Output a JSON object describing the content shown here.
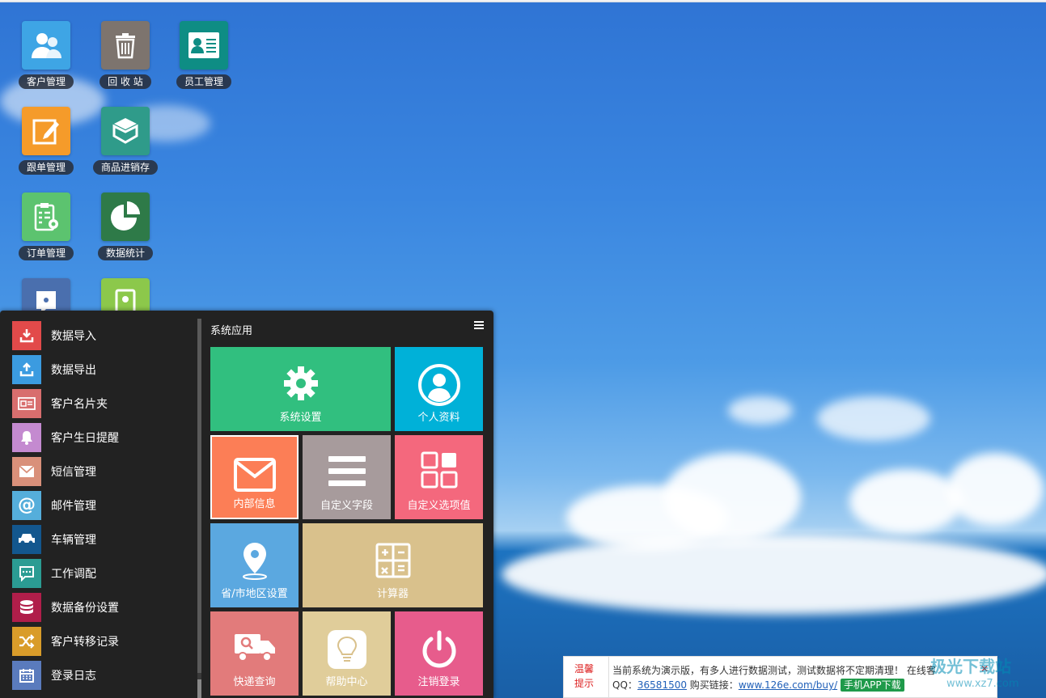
{
  "desktop": {
    "icons": [
      {
        "label": "客户管理",
        "color": "#3ea5e5",
        "icon": "customers-icon"
      },
      {
        "label": "回 收 站",
        "color": "#7d746e",
        "icon": "trash-icon"
      },
      {
        "label": "员工管理",
        "color": "#0e8d84",
        "icon": "id-card-icon"
      },
      {
        "label": "跟单管理",
        "color": "#f59b2a",
        "icon": "edit-icon"
      },
      {
        "label": "商品进销存",
        "color": "#2f9b8a",
        "icon": "box-icon"
      },
      {
        "label": "订单管理",
        "color": "#5cc36f",
        "icon": "clipboard-settings-icon"
      },
      {
        "label": "数据统计",
        "color": "#2e7a48",
        "icon": "pie-chart-icon"
      },
      {
        "label": "",
        "color": "#4a6fae",
        "icon": "chat-icon"
      },
      {
        "label": "",
        "color": "#8cc84b",
        "icon": "contacts-icon"
      }
    ]
  },
  "start_menu": {
    "items": [
      {
        "label": "数据导入",
        "color": "#e24a4a",
        "icon": "download-icon"
      },
      {
        "label": "数据导出",
        "color": "#3b9be0",
        "icon": "upload-icon"
      },
      {
        "label": "客户名片夹",
        "color": "#d86e6e",
        "icon": "business-card-icon"
      },
      {
        "label": "客户生日提醒",
        "color": "#c48ad0",
        "icon": "bell-icon"
      },
      {
        "label": "短信管理",
        "color": "#d9907a",
        "icon": "mail-icon"
      },
      {
        "label": "邮件管理",
        "color": "#55aedb",
        "icon": "at-icon"
      },
      {
        "label": "车辆管理",
        "color": "#13578e",
        "icon": "car-icon"
      },
      {
        "label": "工作调配",
        "color": "#2b9c93",
        "icon": "message-icon"
      },
      {
        "label": "数据备份设置",
        "color": "#b01e4a",
        "icon": "database-icon"
      },
      {
        "label": "客户转移记录",
        "color": "#d99c2a",
        "icon": "shuffle-icon"
      },
      {
        "label": "登录日志",
        "color": "#5a7bbd",
        "icon": "calendar-icon"
      }
    ],
    "section_title": "系统应用",
    "tiles": [
      {
        "label": "系统设置",
        "color": "#31bf7f",
        "icon": "gear-icon"
      },
      {
        "label": "个人资料",
        "color": "#00b1d8",
        "icon": "user-circle-icon"
      },
      {
        "label": "内部信息",
        "color": "#fc7e56",
        "icon": "envelope-icon"
      },
      {
        "label": "自定义字段",
        "color": "#a79b9c",
        "icon": "list-icon"
      },
      {
        "label": "自定义选项值",
        "color": "#f4687d",
        "icon": "grid-icon"
      },
      {
        "label": "省/市地区设置",
        "color": "#5ba8e0",
        "icon": "map-pin-icon"
      },
      {
        "label": "计算器",
        "color": "#d9c18c",
        "icon": "calculator-icon"
      },
      {
        "label": "快递查询",
        "color": "#e27b7b",
        "icon": "truck-icon"
      },
      {
        "label": "帮助中心",
        "color": "#e0cd9a",
        "icon": "bulb-icon"
      },
      {
        "label": "注销登录",
        "color": "#e75c8c",
        "icon": "power-icon"
      }
    ]
  },
  "notice": {
    "tag_line1": "温馨",
    "tag_line2": "提示",
    "line1": "当前系统为演示版，有多人进行数据测试，测试数据将不定期清理！ 在线客",
    "qq_label": "QQ：",
    "qq": "36581500",
    "buy_label": " 购买链接：",
    "buy_url": "www.126e.com/buy/",
    "app_label": "手机APP下载",
    "close": "✕"
  },
  "watermark": {
    "text": "极光下载站",
    "sub": "www.xz7.com"
  }
}
